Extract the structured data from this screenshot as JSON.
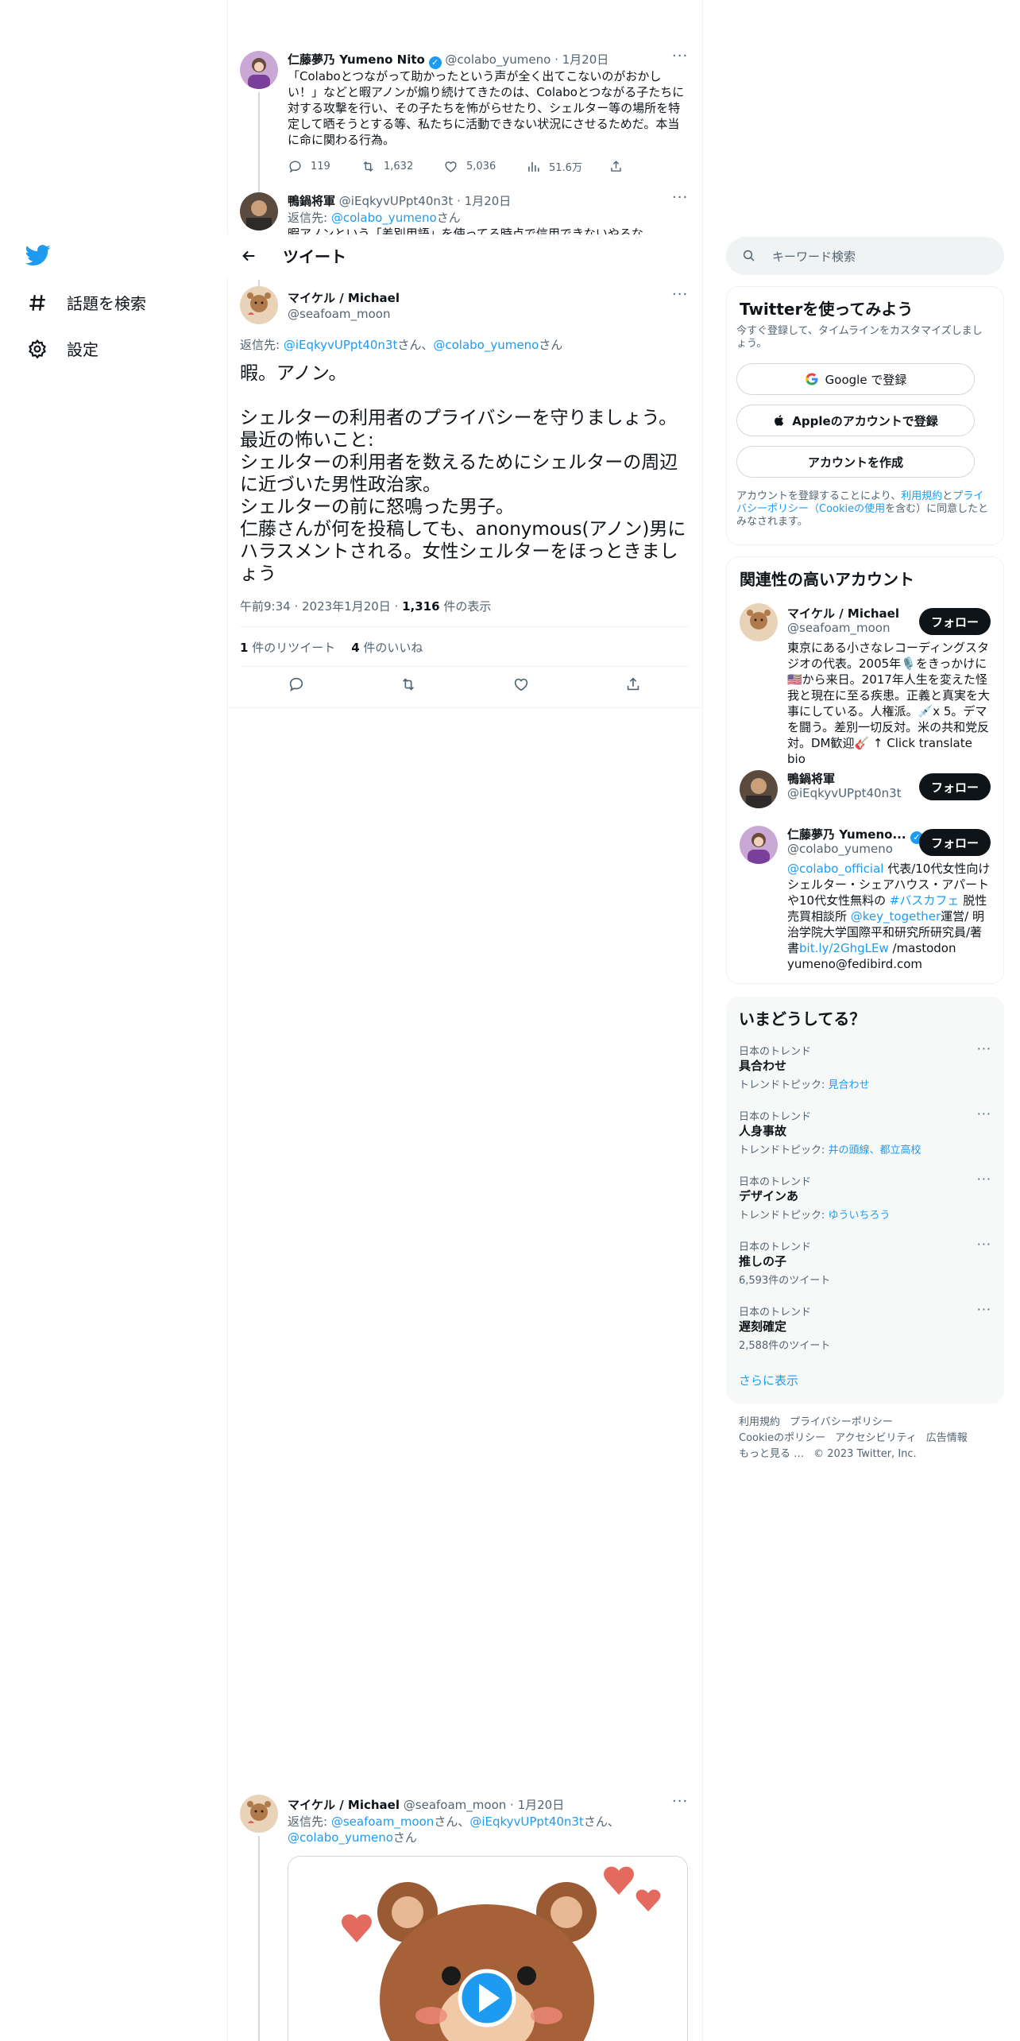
{
  "nav": {
    "explore": "話題を検索",
    "settings": "設定"
  },
  "header": {
    "title": "ツイート"
  },
  "tweets": [
    {
      "name": "仁藤夢乃 Yumeno Nito",
      "handle": "@colabo_yumeno",
      "date": "· 1月20日",
      "text": "「Colaboとつながって助かったという声が全く出てこないのがおかしい！」などと暇アノンが煽り続けてきたのは、Colaboとつながる子たちに対する攻撃を行い、その子たちを怖がらせたり、シェルター等の場所を特定して晒そうとする等、私たちに活動できない状況にさせるためだ。本当に命に関わる行為。",
      "replies": "119",
      "retweets": "1,632",
      "likes": "5,036",
      "views": "51.6万"
    },
    {
      "name": "鴨鍋将軍",
      "handle": "@iEqkyvUPpt40n3t",
      "date": "· 1月20日",
      "reply_prefix": "返信先: ",
      "reply_to": "@colabo_yumeno",
      "reply_suffix": "さん",
      "text": "暇アノンという「差別用語」を使ってる時点で信用できないやろな"
    }
  ],
  "focus": {
    "name": "マイケル / Michael",
    "handle": "@seafoam_moon",
    "reply_prefix": "返信先: ",
    "reply_to_1": "@iEqkyvUPpt40n3t",
    "reply_mid": "さん、",
    "reply_to_2": "@colabo_yumeno",
    "reply_suffix": "さん",
    "text": "暇。アノン。\n\nシェルターの利用者のプライバシーを守りましょう。最近の怖いこと:\nシェルターの利用者を数えるためにシェルターの周辺に近づいた男性政治家。\nシェルターの前に怒鳴った男子。\n仁藤さんが何を投稿しても、anonymous(アノン)男にハラスメントされる。女性シェルターをほっときましょう",
    "time": "午前9:34 · 2023年1月20日 · ",
    "views_num": "1,316",
    "views_label": " 件の表示",
    "retweets_num": "1",
    "retweets_label": " 件のリツイート",
    "likes_num": "4",
    "likes_label": " 件のいいね"
  },
  "bottom_tweet": {
    "name": "マイケル / Michael",
    "handle": "@seafoam_moon",
    "date": "· 1月20日",
    "reply_prefix": "返信先: ",
    "reply_to_1": "@seafoam_moon",
    "reply_mid_1": "さん、",
    "reply_to_2": "@iEqkyvUPpt40n3t",
    "reply_mid_2": "さん、",
    "reply_to_3": "@colabo_yumeno",
    "reply_suffix": "さん"
  },
  "sidebar": {
    "search_placeholder": "キーワード検索",
    "signup": {
      "title": "Twitterを使ってみよう",
      "subtitle": "今すぐ登録して、タイムラインをカスタマイズしましょう。",
      "google": "Google で登録",
      "apple": "Appleのアカウントで登録",
      "create": "アカウントを作成",
      "legal_1": "アカウントを登録することにより、",
      "legal_terms": "利用規約",
      "legal_2": "と",
      "legal_privacy": "プライバシーポリシー（Cookieの使用",
      "legal_3": "を含む）に同意したとみなされます。"
    },
    "related": {
      "title": "関連性の高いアカウント",
      "follow": "フォロー",
      "accounts": [
        {
          "name": "マイケル / Michael",
          "handle": "@seafoam_moon",
          "bio": "東京にある小さなレコーディングスタジオの代表。2005年🎙️をきっかけに🇺🇸から来日。2017年人生を変えた怪我と現在に至る疾患。正義と真実を大事にしている。人権派。💉x 5。デマを闘う。差別一切反対。米の共和党反対。DM歓迎🎸 ↑ Click translate bio"
        },
        {
          "name": "鴨鍋将軍",
          "handle": "@iEqkyvUPpt40n3t",
          "bio": ""
        },
        {
          "name": "仁藤夢乃 Yumeno...",
          "handle": "@colabo_yumeno",
          "bio_link_1": "@colabo_official",
          "bio_1": " 代表/10代女性向けシェルター・シェアハウス・アパートや10代女性無料の ",
          "bio_link_2": "#バスカフェ",
          "bio_2": " 脱性売買相談所 ",
          "bio_link_3": "@key_together",
          "bio_3": "運営/ 明治学院大学国際平和研究所研究員/著書",
          "bio_link_4": "bit.ly/2GhgLEw",
          "bio_4": " /mastodon yumeno@fedibird.com"
        }
      ]
    },
    "trends": {
      "title": "いまどうしてる？",
      "items": [
        {
          "category": "日本のトレンド",
          "name": "具合わせ",
          "sub_label": "トレンドトピック: ",
          "sub_link": "見合わせ"
        },
        {
          "category": "日本のトレンド",
          "name": "人身事故",
          "sub_label": "トレンドトピック: ",
          "sub_link": "井の頭線、都立高校"
        },
        {
          "category": "日本のトレンド",
          "name": "デザインあ",
          "sub_label": "トレンドトピック: ",
          "sub_link": "ゆういちろう"
        },
        {
          "category": "日本のトレンド",
          "name": "推しの子",
          "sub_label": "6,593件のツイート",
          "sub_link": ""
        },
        {
          "category": "日本のトレンド",
          "name": "遅刻確定",
          "sub_label": "2,588件のツイート",
          "sub_link": ""
        }
      ],
      "show_more": "さらに表示"
    },
    "footer": {
      "terms": "利用規約",
      "privacy": "プライバシーポリシー",
      "cookie": "Cookieのポリシー",
      "accessibility": "アクセシビリティ",
      "ads": "広告情報",
      "more": "もっと見る …",
      "copyright": "© 2023 Twitter, Inc."
    }
  },
  "colors": {
    "accent": "#1d9bf0",
    "text": "#0f1419",
    "muted": "#536471",
    "border": "#eff3f4",
    "button_dark": "#0f1419"
  }
}
